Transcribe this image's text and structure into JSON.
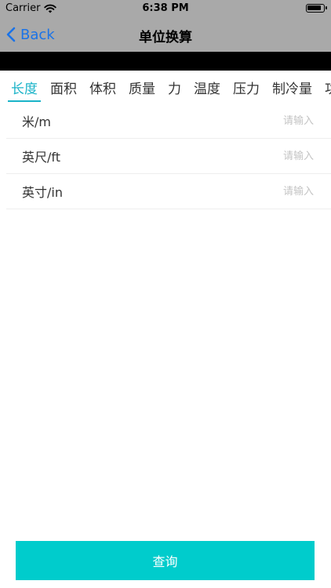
{
  "status_bar": {
    "carrier": "Carrier",
    "time": "6:38 PM"
  },
  "nav": {
    "back_label": "Back",
    "title": "单位换算"
  },
  "tabs": [
    {
      "label": "长度",
      "active": true
    },
    {
      "label": "面积"
    },
    {
      "label": "体积"
    },
    {
      "label": "质量"
    },
    {
      "label": "力"
    },
    {
      "label": "温度"
    },
    {
      "label": "压力"
    },
    {
      "label": "制冷量"
    },
    {
      "label": "功"
    }
  ],
  "units": [
    {
      "label": "米/m",
      "value": "",
      "placeholder": "请输入"
    },
    {
      "label": "英尺/ft",
      "value": "",
      "placeholder": "请输入"
    },
    {
      "label": "英寸/in",
      "value": "",
      "placeholder": "请输入"
    }
  ],
  "query_button": {
    "label": "查询"
  },
  "colors": {
    "accent": "#1ab3c8",
    "button": "#00cccc",
    "bar": "#a9a9a9",
    "link": "#1a73e8"
  }
}
